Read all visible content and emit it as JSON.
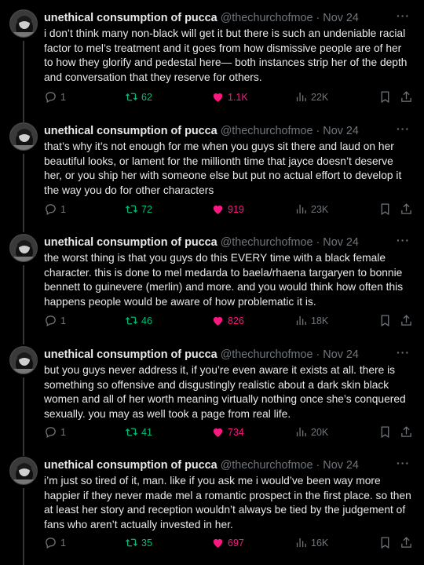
{
  "author": {
    "name": "unethical consumption of pucca",
    "handle": "@thechurchofmoe"
  },
  "icons": {
    "more": "more-icon",
    "reply": "reply-icon",
    "retweet": "retweet-icon",
    "like": "heart-icon",
    "views": "views-icon",
    "bookmark": "bookmark-icon",
    "share": "share-icon"
  },
  "colors": {
    "retweet": "#00ba7c",
    "like": "#f91880",
    "muted": "#71767b"
  },
  "tweets": [
    {
      "date": "Nov 24",
      "text": "i don’t think many non-black will get it but there is such an undeniable racial factor to mel’s treatment and it goes from how dismissive people are of her to how they glorify and pedestal here— both instances strip her of the depth and conversation that they reserve for others.",
      "replies": "1",
      "retweets": "62",
      "likes": "1.1K",
      "views": "22K"
    },
    {
      "date": "Nov 24",
      "text": "that’s why it’s not enough for me when you guys sit there and laud on her beautiful looks, or lament for the millionth time that jayce doesn’t deserve her, or you ship her with someone else but put no actual effort to develop it the way you do for other characters",
      "replies": "1",
      "retweets": "72",
      "likes": "919",
      "views": "23K"
    },
    {
      "date": "Nov 24",
      "text": "the worst thing is that you guys do this EVERY time with a black female character. this is done to mel medarda to baela/rhaena targaryen to bonnie bennett to guinevere (merlin) and more. and you would think how often this happens people would be aware of how problematic it is.",
      "replies": "1",
      "retweets": "46",
      "likes": "826",
      "views": "18K"
    },
    {
      "date": "Nov 24",
      "text": "but you guys never address it, if you’re even aware it exists at all. there is something so offensive and disgustingly realistic about a dark skin black women and all of her worth meaning virtually nothing once she’s conquered sexually. you may as well took a page from real life.",
      "replies": "1",
      "retweets": "41",
      "likes": "734",
      "views": "20K"
    },
    {
      "date": "Nov 24",
      "text": "i’m just so tired of it, man. like if you ask me i would’ve been way more happier if they never made mel a romantic prospect in the first place. so then at least her story and reception wouldn’t always be tied by the judgement of fans who aren’t actually invested in her.",
      "replies": "1",
      "retweets": "35",
      "likes": "697",
      "views": "16K"
    }
  ]
}
